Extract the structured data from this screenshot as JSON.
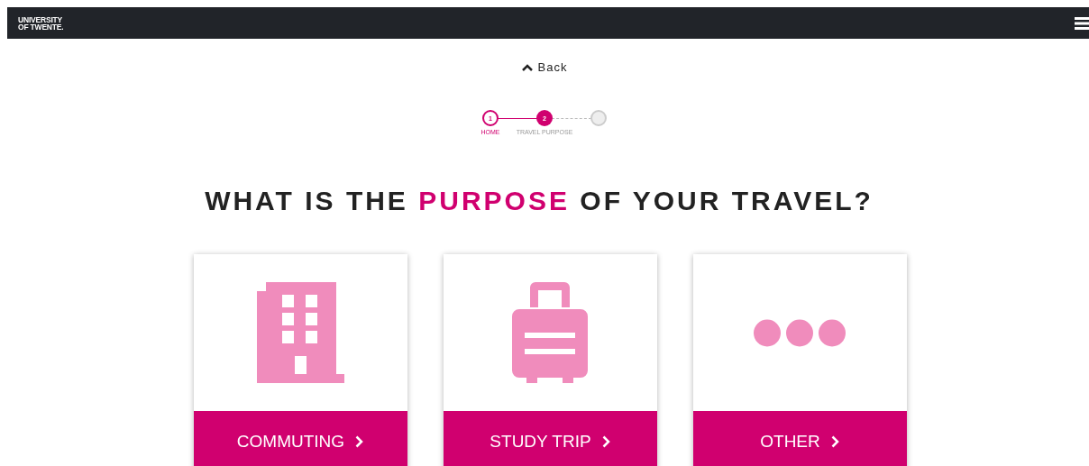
{
  "header": {
    "logo_lines": [
      "UNIVERSITY",
      "OF TWENTE."
    ]
  },
  "back": {
    "label": "Back"
  },
  "steps": [
    {
      "number": "1",
      "label": "HOME",
      "completed": true,
      "selected": false
    },
    {
      "number": "2",
      "label": "TRAVEL PURPOSE",
      "completed": false,
      "selected": true
    },
    {
      "completed": false,
      "selected": false
    }
  ],
  "heading": {
    "before": "WHAT IS THE",
    "highlight": "PURPOSE",
    "after": "OF YOUR TRAVEL?"
  },
  "options": [
    {
      "kind": "building",
      "label": "COMMUTING"
    },
    {
      "kind": "suitcase",
      "label": "STUDY TRIP"
    },
    {
      "kind": "dots",
      "label": "OTHER"
    }
  ]
}
